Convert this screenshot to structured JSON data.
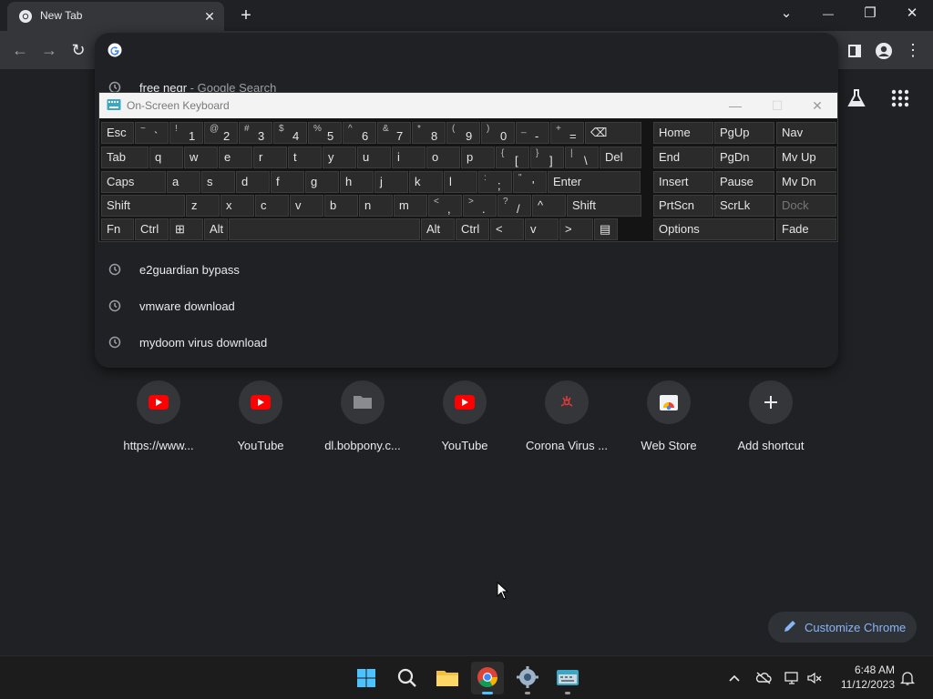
{
  "browser": {
    "tab_title": "New Tab",
    "tab_close": "✕",
    "new_tab": "+",
    "window_controls": {
      "tablist": "⌄",
      "minimize": "—",
      "restore": "❐",
      "close": "✕"
    },
    "toolbar": {
      "back": "←",
      "forward": "→",
      "reload": "↻",
      "menu": "⋮"
    }
  },
  "omnibox": {
    "suggestions": [
      {
        "text": "free negr",
        "suffix": " - Google Search"
      },
      {
        "text": "e2guardian bypass",
        "suffix": ""
      },
      {
        "text": "vmware download",
        "suffix": ""
      },
      {
        "text": "mydoom virus download",
        "suffix": ""
      }
    ]
  },
  "osk": {
    "title": "On-Screen Keyboard",
    "controls": {
      "minimize": "—",
      "maximize": "☐",
      "close": "✕"
    },
    "rows": [
      [
        {
          "m": "Esc"
        },
        {
          "s": "~",
          "b": "`"
        },
        {
          "s": "!",
          "b": "1"
        },
        {
          "s": "@",
          "b": "2"
        },
        {
          "s": "#",
          "b": "3"
        },
        {
          "s": "$",
          "b": "4"
        },
        {
          "s": "%",
          "b": "5"
        },
        {
          "s": "^",
          "b": "6"
        },
        {
          "s": "&",
          "b": "7"
        },
        {
          "s": "*",
          "b": "8"
        },
        {
          "s": "(",
          "b": "9"
        },
        {
          "s": ")",
          "b": "0"
        },
        {
          "s": "_",
          "b": "-"
        },
        {
          "s": "+",
          "b": "="
        },
        {
          "m": "⌫"
        }
      ],
      [
        {
          "m": "Tab"
        },
        {
          "m": "q"
        },
        {
          "m": "w"
        },
        {
          "m": "e"
        },
        {
          "m": "r"
        },
        {
          "m": "t"
        },
        {
          "m": "y"
        },
        {
          "m": "u"
        },
        {
          "m": "i"
        },
        {
          "m": "o"
        },
        {
          "m": "p"
        },
        {
          "s": "{",
          "b": "["
        },
        {
          "s": "}",
          "b": "]"
        },
        {
          "s": "|",
          "b": "\\"
        },
        {
          "m": "Del"
        }
      ],
      [
        {
          "m": "Caps"
        },
        {
          "m": "a"
        },
        {
          "m": "s"
        },
        {
          "m": "d"
        },
        {
          "m": "f"
        },
        {
          "m": "g"
        },
        {
          "m": "h"
        },
        {
          "m": "j"
        },
        {
          "m": "k"
        },
        {
          "m": "l"
        },
        {
          "s": ":",
          "b": ";"
        },
        {
          "s": "\"",
          "b": "'"
        },
        {
          "m": "Enter"
        }
      ],
      [
        {
          "m": "Shift"
        },
        {
          "m": "z"
        },
        {
          "m": "x"
        },
        {
          "m": "c"
        },
        {
          "m": "v"
        },
        {
          "m": "b"
        },
        {
          "m": "n"
        },
        {
          "m": "m"
        },
        {
          "s": "<",
          "b": ","
        },
        {
          "s": ">",
          "b": "."
        },
        {
          "s": "?",
          "b": "/"
        },
        {
          "m": "^"
        },
        {
          "m": "Shift"
        }
      ],
      [
        {
          "m": "Fn"
        },
        {
          "m": "Ctrl"
        },
        {
          "m": "⊞"
        },
        {
          "m": "Alt"
        },
        {
          "m": ""
        },
        {
          "m": "Alt"
        },
        {
          "m": "Ctrl"
        },
        {
          "m": "<"
        },
        {
          "m": "v"
        },
        {
          "m": ">"
        },
        {
          "m": "▤"
        }
      ]
    ],
    "nav_keys": [
      [
        "Home",
        "PgUp",
        "Nav"
      ],
      [
        "End",
        "PgDn",
        "Mv Up"
      ],
      [
        "Insert",
        "Pause",
        "Mv Dn"
      ],
      [
        "PrtScn",
        "ScrLk",
        "Dock"
      ],
      [
        "Options",
        "",
        "Fade"
      ]
    ]
  },
  "shortcuts": [
    {
      "label": "https://www...",
      "icon": "youtube-icon"
    },
    {
      "label": "YouTube",
      "icon": "youtube-icon"
    },
    {
      "label": "dl.bobpony.c...",
      "icon": "folder-icon"
    },
    {
      "label": "YouTube",
      "icon": "youtube-icon"
    },
    {
      "label": "Corona Virus ...",
      "icon": "biohazard-icon"
    },
    {
      "label": "Web Store",
      "icon": "web-store-icon"
    },
    {
      "label": "Add shortcut",
      "icon": "plus-icon"
    }
  ],
  "customize_label": "Customize Chrome",
  "taskbar": {
    "time": "6:48 AM",
    "date": "11/12/2023"
  }
}
